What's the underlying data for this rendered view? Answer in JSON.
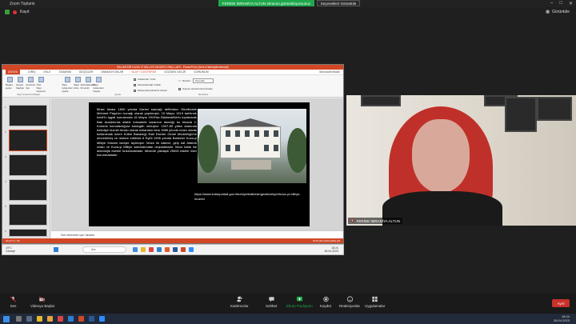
{
  "zoom": {
    "app_title": "Zoom Toplantı",
    "share_banner": "FERİDE İMRANİYA ALTUN ekranını görüntülüyorsunuz",
    "stop_share": "Seçenekleri Görüntüle",
    "record_label": "Kayıt",
    "view_label": "Görüntüle"
  },
  "ppt": {
    "title": "BALIKESİR KUVA-Yİ MİLLİYE MÜZESİ VİNÇ.LARI - PowerPoint (Ürün Etkinleştirmemişti)",
    "tabs": [
      "DOSYA",
      "GİRİŞ",
      "EKLE",
      "TASARIM",
      "GEÇİŞLER",
      "ANİMASYONLAR",
      "SLAYT GÖSTERİSİ",
      "GÖZDEN GEÇİR",
      "GÖRÜNÜM"
    ],
    "account": "Microsoft hesabı",
    "ribbon_buttons": [
      "Başlan-gıçtan",
      "Geçerli Slayttan",
      "Çevrimiçi Sun",
      "Özel Slayt Gösterisi",
      "Slayt Gösterisini Ayarla",
      "Slaytı Gizle",
      "Zamanlamaları Prova Et",
      "Slayt Gösterisini Kaydet"
    ],
    "ribbon_checks": [
      "Anlatımları Yürüt",
      "Zamanlamaları Kullan",
      "Medya Denetimlerini Göster"
    ],
    "monitor_label": "Monitör:",
    "monitor_value": "Otomatik",
    "presenter_check": "Sunucu Görünümünü Kullan",
    "group_labels": [
      "Slayt Gösterisini Başlat",
      "Ayarla",
      "Monitörler"
    ],
    "slide_text": "Müze binası 1840 yılında Karesi sancağı defterdarı Gürzilizade Mehmet Paşa'nın konağı olarak yapılmıştır. 15 Mayıs 1919 tarihinde İzmir'in işgali sonrasında 16 Mayıs 1919'da Balıkesirlilerin toplanarak Batı Anadolu'da silahlı mücadele kararının alındığı bu binada 2. Kolordu komutanlığına karargâh olmuştur. 1947-89 yılları arasında belediye hizmet binası olarak kullanılan bina 1988 yılında müze olarak kullanılmak üzere Kültür Bakanlığı Eski Eserler Genel Müdürlüğü'ne devredilmiş ve restore edilerek 6 Eylül 1996 yılında Balıkesir Kuva-yi Milliye Müzesi ismiyle açılmıştır. Müze iki katlıdır, giriş kat Atatürk odası ve Kuva-yi Milliye salonlarından oluşmaktadır. İkinci katta ise arkeolojik eserler bulunmaktadır. Müzede yaklaşık 25000 eskiler eser korunmaktadır.",
    "slide_link": "https://www.kulturportali.gov.tr/turkiye/balikesir/gezilecekyer/kuva-yi-milliye-muzesi",
    "slide_numbers": [
      "1",
      "2",
      "3",
      "4",
      "5",
      "6"
    ],
    "notes_placeholder": "Not eklemek için tıklatın",
    "status_left": "SLAYT 2 / 46",
    "status_right": "NOTLAR  AÇIKLAMALAR"
  },
  "inner_taskbar": {
    "weather_temp": "19°C",
    "weather_desc": "Güneşli",
    "search": "Ara",
    "time": "18:24",
    "date": "28.04.2023"
  },
  "participant": {
    "name": "FERİDE İMRANİYA ALTUN"
  },
  "toolbar": {
    "audio": "Ses",
    "video": "Videoyu Başlat",
    "participants": "Katılımcılar",
    "participants_count": "2",
    "chat": "Sohbet",
    "share": "Ekran Paylaşımı",
    "record": "Kaydet",
    "reactions": "Reaksiyonlar",
    "apps": "Uygulamalar",
    "leave": "Ayrıl"
  },
  "taskbar": {
    "time": "18:24",
    "date": "28.04.2023"
  },
  "colors": {
    "ppt_accent": "#d24726",
    "share_green": "#1fa84b",
    "leave_red": "#c8302a"
  }
}
